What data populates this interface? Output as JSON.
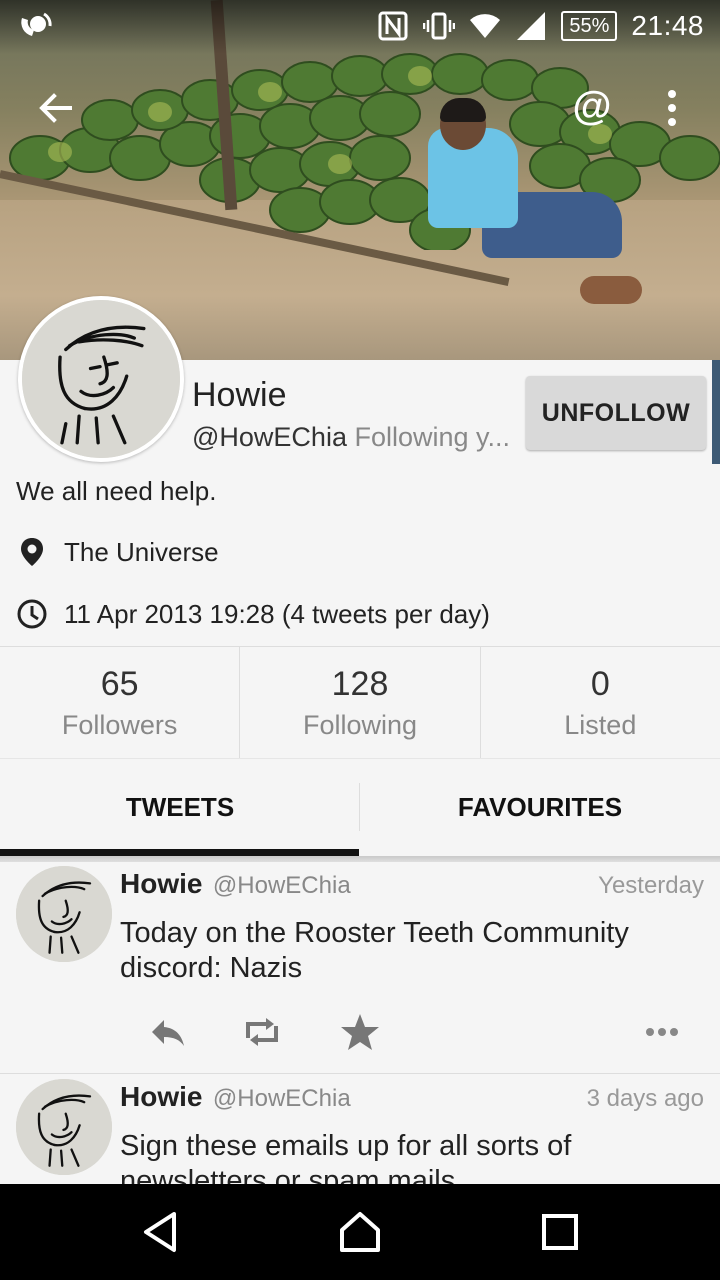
{
  "status_bar": {
    "battery": "55%",
    "time": "21:48"
  },
  "profile": {
    "name": "Howie",
    "handle": "@HowEChia",
    "follow_status": "Following y...",
    "unfollow_label": "UNFOLLOW",
    "bio": "We all need help.",
    "location": "The Universe",
    "joined": "11 Apr 2013 19:28 (4 tweets per day)"
  },
  "stats": [
    {
      "value": "65",
      "label": "Followers"
    },
    {
      "value": "128",
      "label": "Following"
    },
    {
      "value": "0",
      "label": "Listed"
    }
  ],
  "tabs": [
    {
      "label": "TWEETS",
      "selected": true
    },
    {
      "label": "FAVOURITES",
      "selected": false
    }
  ],
  "tweets": [
    {
      "name": "Howie",
      "handle": "@HowEChia",
      "time": "Yesterday",
      "text": "Today on the Rooster Teeth Community discord: Nazis"
    },
    {
      "name": "Howie",
      "handle": "@HowEChia",
      "time": "3 days ago",
      "text": "Sign these emails up for all sorts of newsletters or spam mails"
    }
  ],
  "icons": {
    "back": "arrow-left-icon",
    "mention": "at-sign-icon",
    "more": "more-vert-icon",
    "location": "location-pin-icon",
    "clock": "clock-icon",
    "reply": "reply-icon",
    "retweet": "retweet-icon",
    "favorite": "star-icon",
    "overflow": "more-horiz-icon"
  },
  "colors": {
    "background": "#f5f5f5",
    "button": "#d9d9d9",
    "muted_text": "#888888",
    "accent_edge": "#3d5a75"
  }
}
